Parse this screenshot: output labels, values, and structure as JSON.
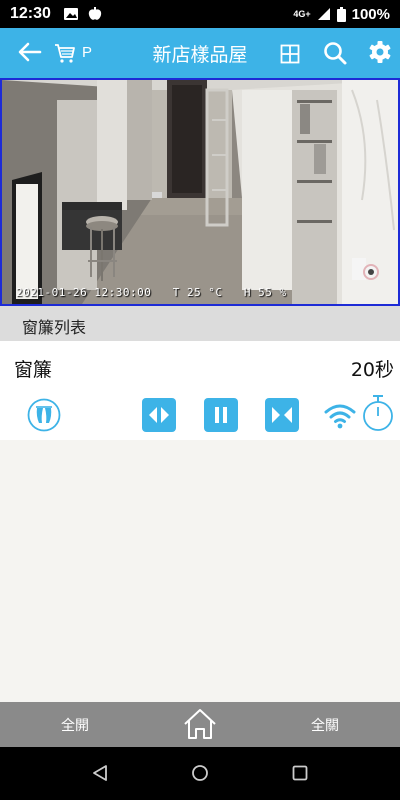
{
  "status_bar": {
    "time": "12:30",
    "network": "4G+",
    "battery": "100%",
    "icons": [
      "image-icon",
      "app-icon",
      "signal-icon",
      "battery-icon"
    ]
  },
  "app_bar": {
    "title": "新店樣品屋",
    "cart_label": "P",
    "accent_color": "#3db3e7"
  },
  "camera": {
    "overlay_text": "2021-01-26 12:30:00   T 25 °C   H 55 %"
  },
  "section": {
    "header": "窗簾列表"
  },
  "device": {
    "name": "窗簾",
    "timer": "20秒",
    "controls": [
      "curtain-type-icon",
      "open-curtain-icon",
      "pause-icon",
      "close-curtain-icon",
      "wifi-icon",
      "stopwatch-icon"
    ]
  },
  "bottom_bar": {
    "open_all": "全開",
    "close_all": "全關"
  },
  "nav_bar": {
    "icons": [
      "back-nav-icon",
      "home-nav-icon",
      "recents-nav-icon"
    ]
  }
}
